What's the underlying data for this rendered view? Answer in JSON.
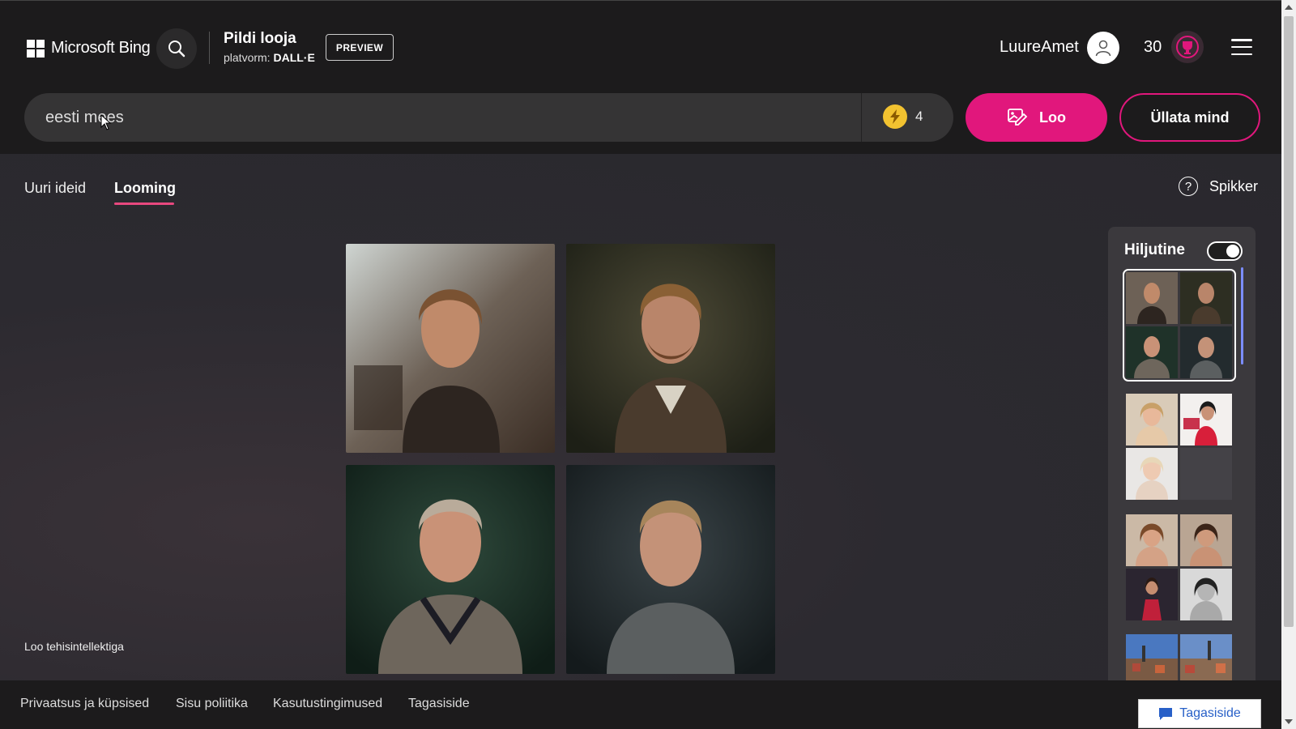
{
  "header": {
    "brand": "Microsoft Bing",
    "app_title": "Pildi looja",
    "platform_label": "platvorm:",
    "platform_name": "DALL·E",
    "preview_badge": "PREVIEW",
    "username": "LuureAmet",
    "points": "30"
  },
  "prompt": {
    "value": "eesti mees",
    "boosts": "4",
    "create_label": "Loo",
    "surprise_label": "Üllata mind"
  },
  "tabs": [
    {
      "label": "Uuri ideid",
      "active": false
    },
    {
      "label": "Looming",
      "active": true
    }
  ],
  "help_label": "Spikker",
  "recent": {
    "title": "Hiljutine",
    "toggle_on": true
  },
  "create_note": "Loo tehisintellektiga",
  "footer": {
    "links": [
      "Privaatsus ja küpsised",
      "Sisu poliitika",
      "Kasutustingimused",
      "Tagasiside"
    ],
    "feedback_button": "Tagasiside"
  },
  "colors": {
    "accent": "#e1177c",
    "background": "#1c1b1c",
    "feedback_blue": "#2860c8"
  },
  "icons": [
    "windows-logo-icon",
    "search-icon",
    "user-avatar-icon",
    "rewards-trophy-icon",
    "hamburger-menu-icon",
    "lightning-boost-icon",
    "image-create-icon",
    "help-icon",
    "feedback-chat-icon"
  ]
}
